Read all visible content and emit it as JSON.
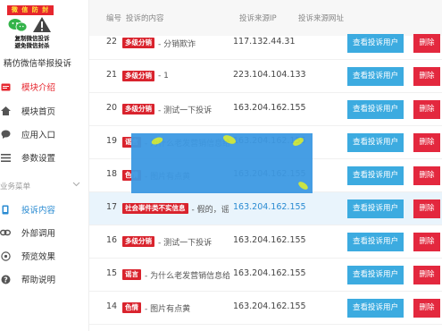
{
  "logo": {
    "banner": "微 信 防 封",
    "line1": "复制微信投诉",
    "line2": "避免微信封杀"
  },
  "site_title": "精仿微信举报投诉",
  "sidebar": {
    "items": [
      {
        "label": "模块介绍",
        "icon": "card-icon",
        "state": "active"
      },
      {
        "label": "模块首页",
        "icon": "home-icon",
        "state": ""
      },
      {
        "label": "应用入口",
        "icon": "chat-icon",
        "state": ""
      },
      {
        "label": "参数设置",
        "icon": "list-icon",
        "state": ""
      }
    ],
    "group_label": "业务菜单",
    "group_items": [
      {
        "label": "投诉内容",
        "icon": "phone-icon",
        "state": "current"
      },
      {
        "label": "外部调用",
        "icon": "link-icon",
        "state": ""
      },
      {
        "label": "预览效果",
        "icon": "eye-icon",
        "state": ""
      },
      {
        "label": "帮助说明",
        "icon": "help-icon",
        "state": ""
      }
    ]
  },
  "table": {
    "headers": {
      "num": "编号",
      "content": "投诉的内容",
      "ip": "投诉来源IP",
      "url": "投诉来源网址"
    },
    "view_label": "查看投诉用户",
    "delete_label": "删除",
    "rows": [
      {
        "num": "22",
        "tag": "多级分销",
        "text": "- 分销欺诈",
        "ip": "117.132.44.31",
        "highlight": false
      },
      {
        "num": "21",
        "tag": "多级分销",
        "text": "- 1",
        "ip": "223.104.104.133",
        "highlight": false
      },
      {
        "num": "20",
        "tag": "多级分销",
        "text": "- 测试一下投诉",
        "ip": "163.204.162.155",
        "highlight": false
      },
      {
        "num": "19",
        "tag": "谣言",
        "text": "- 为什么老发营销信息给我",
        "ip": "163.204.162.155",
        "highlight": false
      },
      {
        "num": "18",
        "tag": "色情",
        "text": "- 图片有点黄",
        "ip": "163.204.162.155",
        "highlight": false
      },
      {
        "num": "17",
        "tag": "社会事件类不实信息",
        "text": "- 假的，谣言",
        "ip": "163.204.162.155",
        "highlight": true
      },
      {
        "num": "16",
        "tag": "多级分销",
        "text": "- 测试一下投诉",
        "ip": "163.204.162.155",
        "highlight": false
      },
      {
        "num": "15",
        "tag": "谣言",
        "text": "- 为什么老发营销信息给我",
        "ip": "163.204.162.155",
        "highlight": false
      },
      {
        "num": "14",
        "tag": "色情",
        "text": "- 图片有点黄",
        "ip": "163.204.162.155",
        "highlight": false
      }
    ]
  },
  "colors": {
    "accent_red": "#e6262e",
    "view_button": "#3cabe0",
    "delete_button": "#e3283e",
    "link_blue": "#2a8bd2",
    "popup_blue": "#3d99e3",
    "highlight_row": "#e9f4fc"
  }
}
